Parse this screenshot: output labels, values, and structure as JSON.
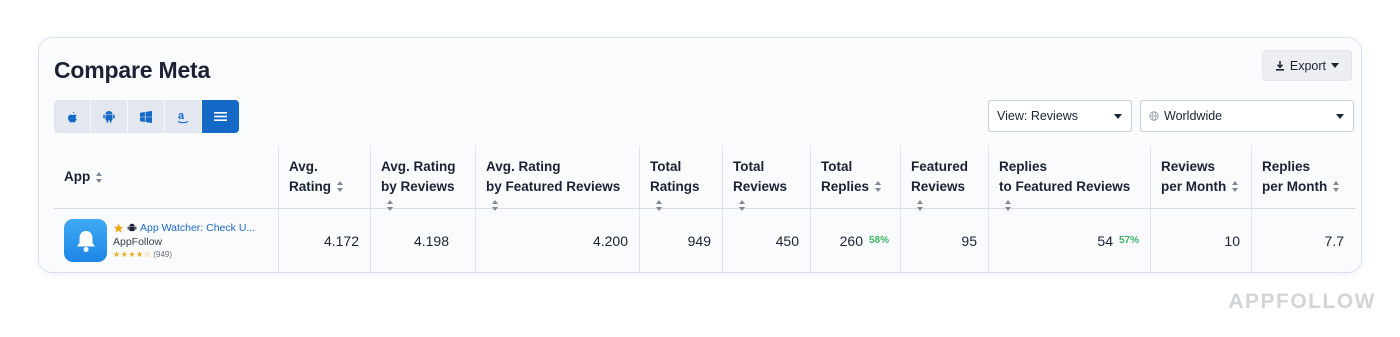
{
  "page": {
    "title": "Compare Meta"
  },
  "toolbar": {
    "export_label": "Export",
    "platforms": [
      {
        "name": "apple",
        "icon": "apple-icon",
        "active": false
      },
      {
        "name": "android",
        "icon": "android-icon",
        "active": false
      },
      {
        "name": "windows",
        "icon": "windows-icon",
        "active": false
      },
      {
        "name": "amazon",
        "icon": "amazon-icon",
        "active": false
      },
      {
        "name": "all",
        "icon": "list-icon",
        "active": true
      }
    ],
    "view_select": "View: Reviews",
    "country_select": "Worldwide"
  },
  "table": {
    "headers": {
      "app": "App",
      "avg_rating": [
        "Avg.",
        "Rating"
      ],
      "avg_rating_reviews": [
        "Avg. Rating",
        "by Reviews"
      ],
      "avg_rating_featured": [
        "Avg. Rating",
        "by Featured Reviews"
      ],
      "total_ratings": [
        "Total",
        "Ratings"
      ],
      "total_reviews": [
        "Total",
        "Reviews"
      ],
      "total_replies": [
        "Total",
        "Replies"
      ],
      "featured_reviews": [
        "Featured",
        "Reviews"
      ],
      "replies_featured": [
        "Replies",
        "to Featured Reviews"
      ],
      "reviews_month": [
        "Reviews",
        "per Month"
      ],
      "replies_month": [
        "Replies",
        "per Month"
      ]
    },
    "row": {
      "app_name": "App Watcher: Check U...",
      "publisher": "AppFollow",
      "stars": "★★★★☆",
      "rating_count": "(949)",
      "avg_rating": "4.172",
      "avg_rating_reviews": "4.198",
      "avg_rating_featured": "4.200",
      "total_ratings": "949",
      "total_reviews": "450",
      "total_replies": "260",
      "total_replies_pct": "58%",
      "featured_reviews": "95",
      "replies_featured": "54",
      "replies_featured_pct": "57%",
      "reviews_month": "10",
      "replies_month": "7.7"
    }
  },
  "watermark": "APPFOLLOW",
  "colors": {
    "accent": "#1469c7",
    "positive": "#3db466",
    "star": "#f0a91b"
  }
}
